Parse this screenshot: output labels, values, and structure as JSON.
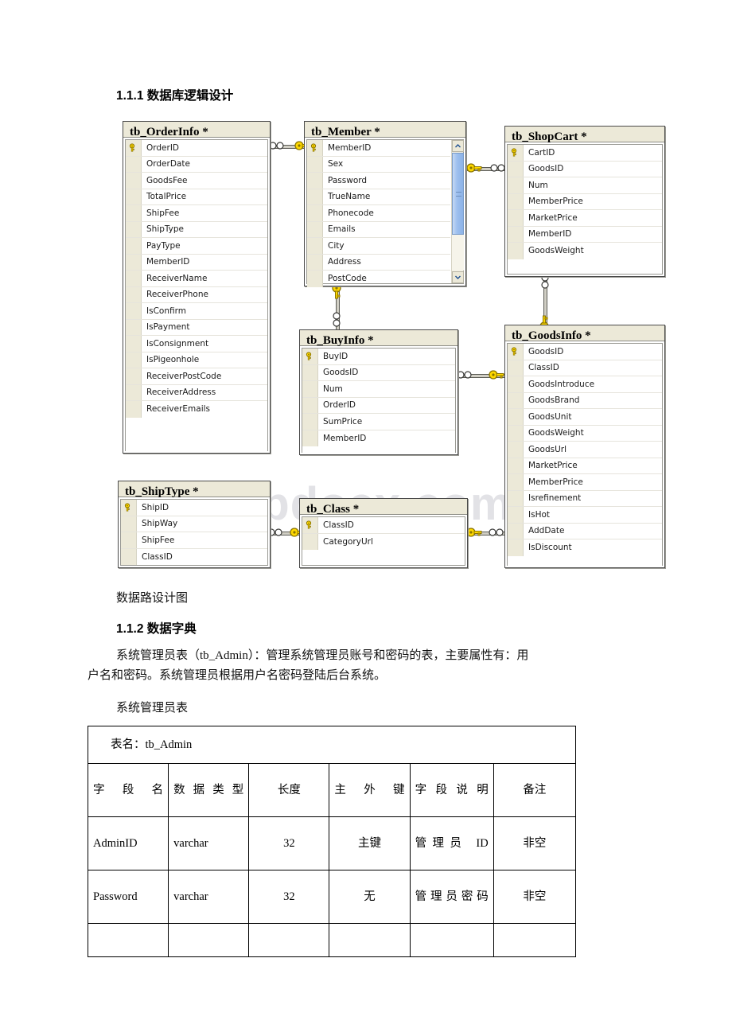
{
  "document": {
    "heading_1": "1.1.1 数据库逻辑设计",
    "caption_diagram": "数据路设计图",
    "heading_2": "1.1.2 数据字典",
    "paragraph_line_1": "系统管理员表（tb_Admin）：管理系统管理员账号和密码的表，主要属性有：用",
    "paragraph_line_2": "户名和密码。系统管理员根据用户名密码登陆后台系统。",
    "caption_table": "系统管理员表",
    "watermark": "www.bdocx.com"
  },
  "er_diagram": {
    "tables": [
      {
        "id": "tb_OrderInfo",
        "title": "tb_OrderInfo *",
        "fields": [
          {
            "name": "OrderID",
            "key": true
          },
          {
            "name": "OrderDate",
            "key": false
          },
          {
            "name": "GoodsFee",
            "key": false
          },
          {
            "name": "TotalPrice",
            "key": false
          },
          {
            "name": "ShipFee",
            "key": false
          },
          {
            "name": "ShipType",
            "key": false
          },
          {
            "name": "PayType",
            "key": false
          },
          {
            "name": "MemberID",
            "key": false
          },
          {
            "name": "ReceiverName",
            "key": false
          },
          {
            "name": "ReceiverPhone",
            "key": false
          },
          {
            "name": "IsConfirm",
            "key": false
          },
          {
            "name": "IsPayment",
            "key": false
          },
          {
            "name": "IsConsignment",
            "key": false
          },
          {
            "name": "IsPigeonhole",
            "key": false
          },
          {
            "name": "ReceiverPostCode",
            "key": false
          },
          {
            "name": "ReceiverAddress",
            "key": false
          },
          {
            "name": "ReceiverEmails",
            "key": false
          }
        ]
      },
      {
        "id": "tb_Member",
        "title": "tb_Member *",
        "scrollbar": true,
        "fields": [
          {
            "name": "MemberID",
            "key": true
          },
          {
            "name": "Sex",
            "key": false
          },
          {
            "name": "Password",
            "key": false
          },
          {
            "name": "TrueName",
            "key": false
          },
          {
            "name": "Phonecode",
            "key": false
          },
          {
            "name": "Emails",
            "key": false
          },
          {
            "name": "City",
            "key": false
          },
          {
            "name": "Address",
            "key": false
          },
          {
            "name": "PostCode",
            "key": false
          }
        ]
      },
      {
        "id": "tb_ShopCart",
        "title": "tb_ShopCart *",
        "fields": [
          {
            "name": "CartID",
            "key": true
          },
          {
            "name": "GoodsID",
            "key": false
          },
          {
            "name": "Num",
            "key": false
          },
          {
            "name": "MemberPrice",
            "key": false
          },
          {
            "name": "MarketPrice",
            "key": false
          },
          {
            "name": "MemberID",
            "key": false
          },
          {
            "name": "GoodsWeight",
            "key": false
          }
        ]
      },
      {
        "id": "tb_BuyInfo",
        "title": "tb_BuyInfo *",
        "fields": [
          {
            "name": "BuyID",
            "key": true
          },
          {
            "name": "GoodsID",
            "key": false
          },
          {
            "name": "Num",
            "key": false
          },
          {
            "name": "OrderID",
            "key": false
          },
          {
            "name": "SumPrice",
            "key": false
          },
          {
            "name": "MemberID",
            "key": false
          }
        ]
      },
      {
        "id": "tb_GoodsInfo",
        "title": "tb_GoodsInfo *",
        "fields": [
          {
            "name": "GoodsID",
            "key": true
          },
          {
            "name": "ClassID",
            "key": false
          },
          {
            "name": "GoodsIntroduce",
            "key": false
          },
          {
            "name": "GoodsBrand",
            "key": false
          },
          {
            "name": "GoodsUnit",
            "key": false
          },
          {
            "name": "GoodsWeight",
            "key": false
          },
          {
            "name": "GoodsUrl",
            "key": false
          },
          {
            "name": "MarketPrice",
            "key": false
          },
          {
            "name": "MemberPrice",
            "key": false
          },
          {
            "name": "Isrefinement",
            "key": false
          },
          {
            "name": "IsHot",
            "key": false
          },
          {
            "name": "AddDate",
            "key": false
          },
          {
            "name": "IsDiscount",
            "key": false
          }
        ]
      },
      {
        "id": "tb_ShipType",
        "title": "tb_ShipType *",
        "fields": [
          {
            "name": "ShipID",
            "key": true
          },
          {
            "name": "ShipWay",
            "key": false
          },
          {
            "name": "ShipFee",
            "key": false
          },
          {
            "name": "ClassID",
            "key": false
          }
        ]
      },
      {
        "id": "tb_Class",
        "title": "tb_Class *",
        "fields": [
          {
            "name": "ClassID",
            "key": true
          },
          {
            "name": "CategoryUrl",
            "key": false
          }
        ]
      }
    ],
    "relationships": [
      {
        "from": "tb_OrderInfo",
        "to": "tb_Member",
        "from_card": "many",
        "to_card": "one"
      },
      {
        "from": "tb_Member",
        "to": "tb_ShopCart",
        "from_card": "one",
        "to_card": "many"
      },
      {
        "from": "tb_Member",
        "to": "tb_BuyInfo",
        "from_card": "one",
        "to_card": "many"
      },
      {
        "from": "tb_BuyInfo",
        "to": "tb_GoodsInfo",
        "from_card": "many",
        "to_card": "one"
      },
      {
        "from": "tb_GoodsInfo",
        "to": "tb_ShopCart",
        "from_card": "one",
        "to_card": "many"
      },
      {
        "from": "tb_ShipType",
        "to": "tb_Class",
        "from_card": "many",
        "to_card": "one"
      },
      {
        "from": "tb_Class",
        "to": "tb_GoodsInfo",
        "from_card": "one",
        "to_card": "many"
      }
    ]
  },
  "dictionary_table": {
    "title": "表名：tb_Admin",
    "headers": [
      "字段名",
      "数据类型",
      "长度",
      "主外键",
      "字段说明",
      "备注"
    ],
    "rows": [
      [
        "AdminID",
        "varchar",
        "32",
        "主键",
        "管理员 ID",
        "非空"
      ],
      [
        "Password",
        "varchar",
        "32",
        "无",
        "管理员密码",
        "非空"
      ],
      [
        "",
        "",
        "",
        "",
        "",
        ""
      ]
    ]
  }
}
